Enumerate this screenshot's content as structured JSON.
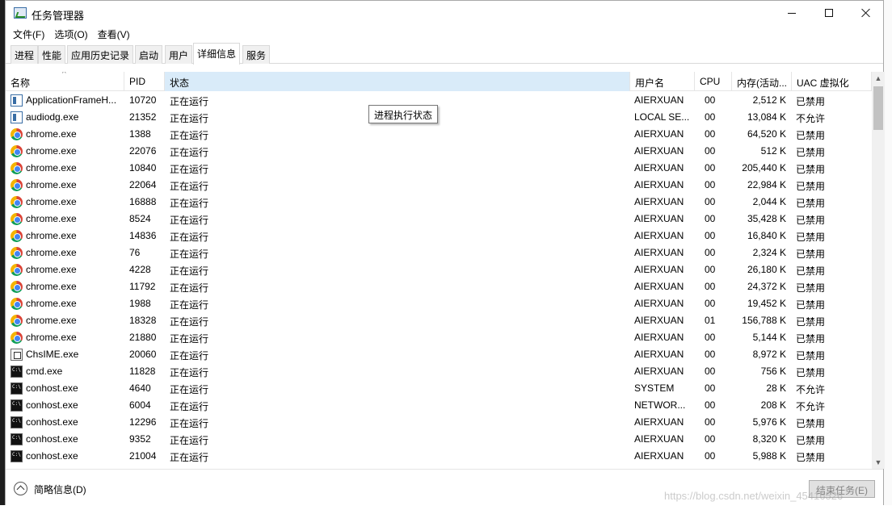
{
  "window": {
    "title": "任务管理器",
    "controls": {
      "minimize": "minimize",
      "maximize": "maximize",
      "close": "close"
    }
  },
  "menu": [
    "文件(F)",
    "选项(O)",
    "查看(V)"
  ],
  "tabs": [
    "进程",
    "性能",
    "应用历史记录",
    "启动",
    "用户",
    "详细信息",
    "服务"
  ],
  "active_tab": "详细信息",
  "columns": {
    "name": "名称",
    "pid": "PID",
    "status": "状态",
    "user": "用户名",
    "cpu": "CPU",
    "memory": "内存(活动...",
    "uac": "UAC 虚拟化"
  },
  "tooltip": "进程执行状态",
  "processes": [
    {
      "icon": "app-frame-icon",
      "name": "ApplicationFrameH...",
      "pid": "10720",
      "status": "正在运行",
      "user": "AIERXUAN",
      "cpu": "00",
      "memory": "2,512 K",
      "uac": "已禁用"
    },
    {
      "icon": "app-frame-icon",
      "name": "audiodg.exe",
      "pid": "21352",
      "status": "正在运行",
      "user": "LOCAL SE...",
      "cpu": "00",
      "memory": "13,084 K",
      "uac": "不允许"
    },
    {
      "icon": "chrome-icon",
      "name": "chrome.exe",
      "pid": "1388",
      "status": "正在运行",
      "user": "AIERXUAN",
      "cpu": "00",
      "memory": "64,520 K",
      "uac": "已禁用"
    },
    {
      "icon": "chrome-icon",
      "name": "chrome.exe",
      "pid": "22076",
      "status": "正在运行",
      "user": "AIERXUAN",
      "cpu": "00",
      "memory": "512 K",
      "uac": "已禁用"
    },
    {
      "icon": "chrome-icon",
      "name": "chrome.exe",
      "pid": "10840",
      "status": "正在运行",
      "user": "AIERXUAN",
      "cpu": "00",
      "memory": "205,440 K",
      "uac": "已禁用"
    },
    {
      "icon": "chrome-icon",
      "name": "chrome.exe",
      "pid": "22064",
      "status": "正在运行",
      "user": "AIERXUAN",
      "cpu": "00",
      "memory": "22,984 K",
      "uac": "已禁用"
    },
    {
      "icon": "chrome-icon",
      "name": "chrome.exe",
      "pid": "16888",
      "status": "正在运行",
      "user": "AIERXUAN",
      "cpu": "00",
      "memory": "2,044 K",
      "uac": "已禁用"
    },
    {
      "icon": "chrome-icon",
      "name": "chrome.exe",
      "pid": "8524",
      "status": "正在运行",
      "user": "AIERXUAN",
      "cpu": "00",
      "memory": "35,428 K",
      "uac": "已禁用"
    },
    {
      "icon": "chrome-icon",
      "name": "chrome.exe",
      "pid": "14836",
      "status": "正在运行",
      "user": "AIERXUAN",
      "cpu": "00",
      "memory": "16,840 K",
      "uac": "已禁用"
    },
    {
      "icon": "chrome-icon",
      "name": "chrome.exe",
      "pid": "76",
      "status": "正在运行",
      "user": "AIERXUAN",
      "cpu": "00",
      "memory": "2,324 K",
      "uac": "已禁用"
    },
    {
      "icon": "chrome-icon",
      "name": "chrome.exe",
      "pid": "4228",
      "status": "正在运行",
      "user": "AIERXUAN",
      "cpu": "00",
      "memory": "26,180 K",
      "uac": "已禁用"
    },
    {
      "icon": "chrome-icon",
      "name": "chrome.exe",
      "pid": "11792",
      "status": "正在运行",
      "user": "AIERXUAN",
      "cpu": "00",
      "memory": "24,372 K",
      "uac": "已禁用"
    },
    {
      "icon": "chrome-icon",
      "name": "chrome.exe",
      "pid": "1988",
      "status": "正在运行",
      "user": "AIERXUAN",
      "cpu": "00",
      "memory": "19,452 K",
      "uac": "已禁用"
    },
    {
      "icon": "chrome-icon",
      "name": "chrome.exe",
      "pid": "18328",
      "status": "正在运行",
      "user": "AIERXUAN",
      "cpu": "01",
      "memory": "156,788 K",
      "uac": "已禁用"
    },
    {
      "icon": "chrome-icon",
      "name": "chrome.exe",
      "pid": "21880",
      "status": "正在运行",
      "user": "AIERXUAN",
      "cpu": "00",
      "memory": "5,144 K",
      "uac": "已禁用"
    },
    {
      "icon": "ime-icon",
      "name": "ChsIME.exe",
      "pid": "20060",
      "status": "正在运行",
      "user": "AIERXUAN",
      "cpu": "00",
      "memory": "8,972 K",
      "uac": "已禁用"
    },
    {
      "icon": "cmd-icon",
      "name": "cmd.exe",
      "pid": "11828",
      "status": "正在运行",
      "user": "AIERXUAN",
      "cpu": "00",
      "memory": "756 K",
      "uac": "已禁用"
    },
    {
      "icon": "cmd-icon",
      "name": "conhost.exe",
      "pid": "4640",
      "status": "正在运行",
      "user": "SYSTEM",
      "cpu": "00",
      "memory": "28 K",
      "uac": "不允许"
    },
    {
      "icon": "cmd-icon",
      "name": "conhost.exe",
      "pid": "6004",
      "status": "正在运行",
      "user": "NETWOR...",
      "cpu": "00",
      "memory": "208 K",
      "uac": "不允许"
    },
    {
      "icon": "cmd-icon",
      "name": "conhost.exe",
      "pid": "12296",
      "status": "正在运行",
      "user": "AIERXUAN",
      "cpu": "00",
      "memory": "5,976 K",
      "uac": "已禁用"
    },
    {
      "icon": "cmd-icon",
      "name": "conhost.exe",
      "pid": "9352",
      "status": "正在运行",
      "user": "AIERXUAN",
      "cpu": "00",
      "memory": "8,320 K",
      "uac": "已禁用"
    },
    {
      "icon": "cmd-icon",
      "name": "conhost.exe",
      "pid": "21004",
      "status": "正在运行",
      "user": "AIERXUAN",
      "cpu": "00",
      "memory": "5,988 K",
      "uac": "已禁用"
    }
  ],
  "footer": {
    "collapse_label": "简略信息(D)",
    "end_task_label": "结束任务(E)"
  },
  "watermark": "https://blog.csdn.net/weixin_45416526"
}
